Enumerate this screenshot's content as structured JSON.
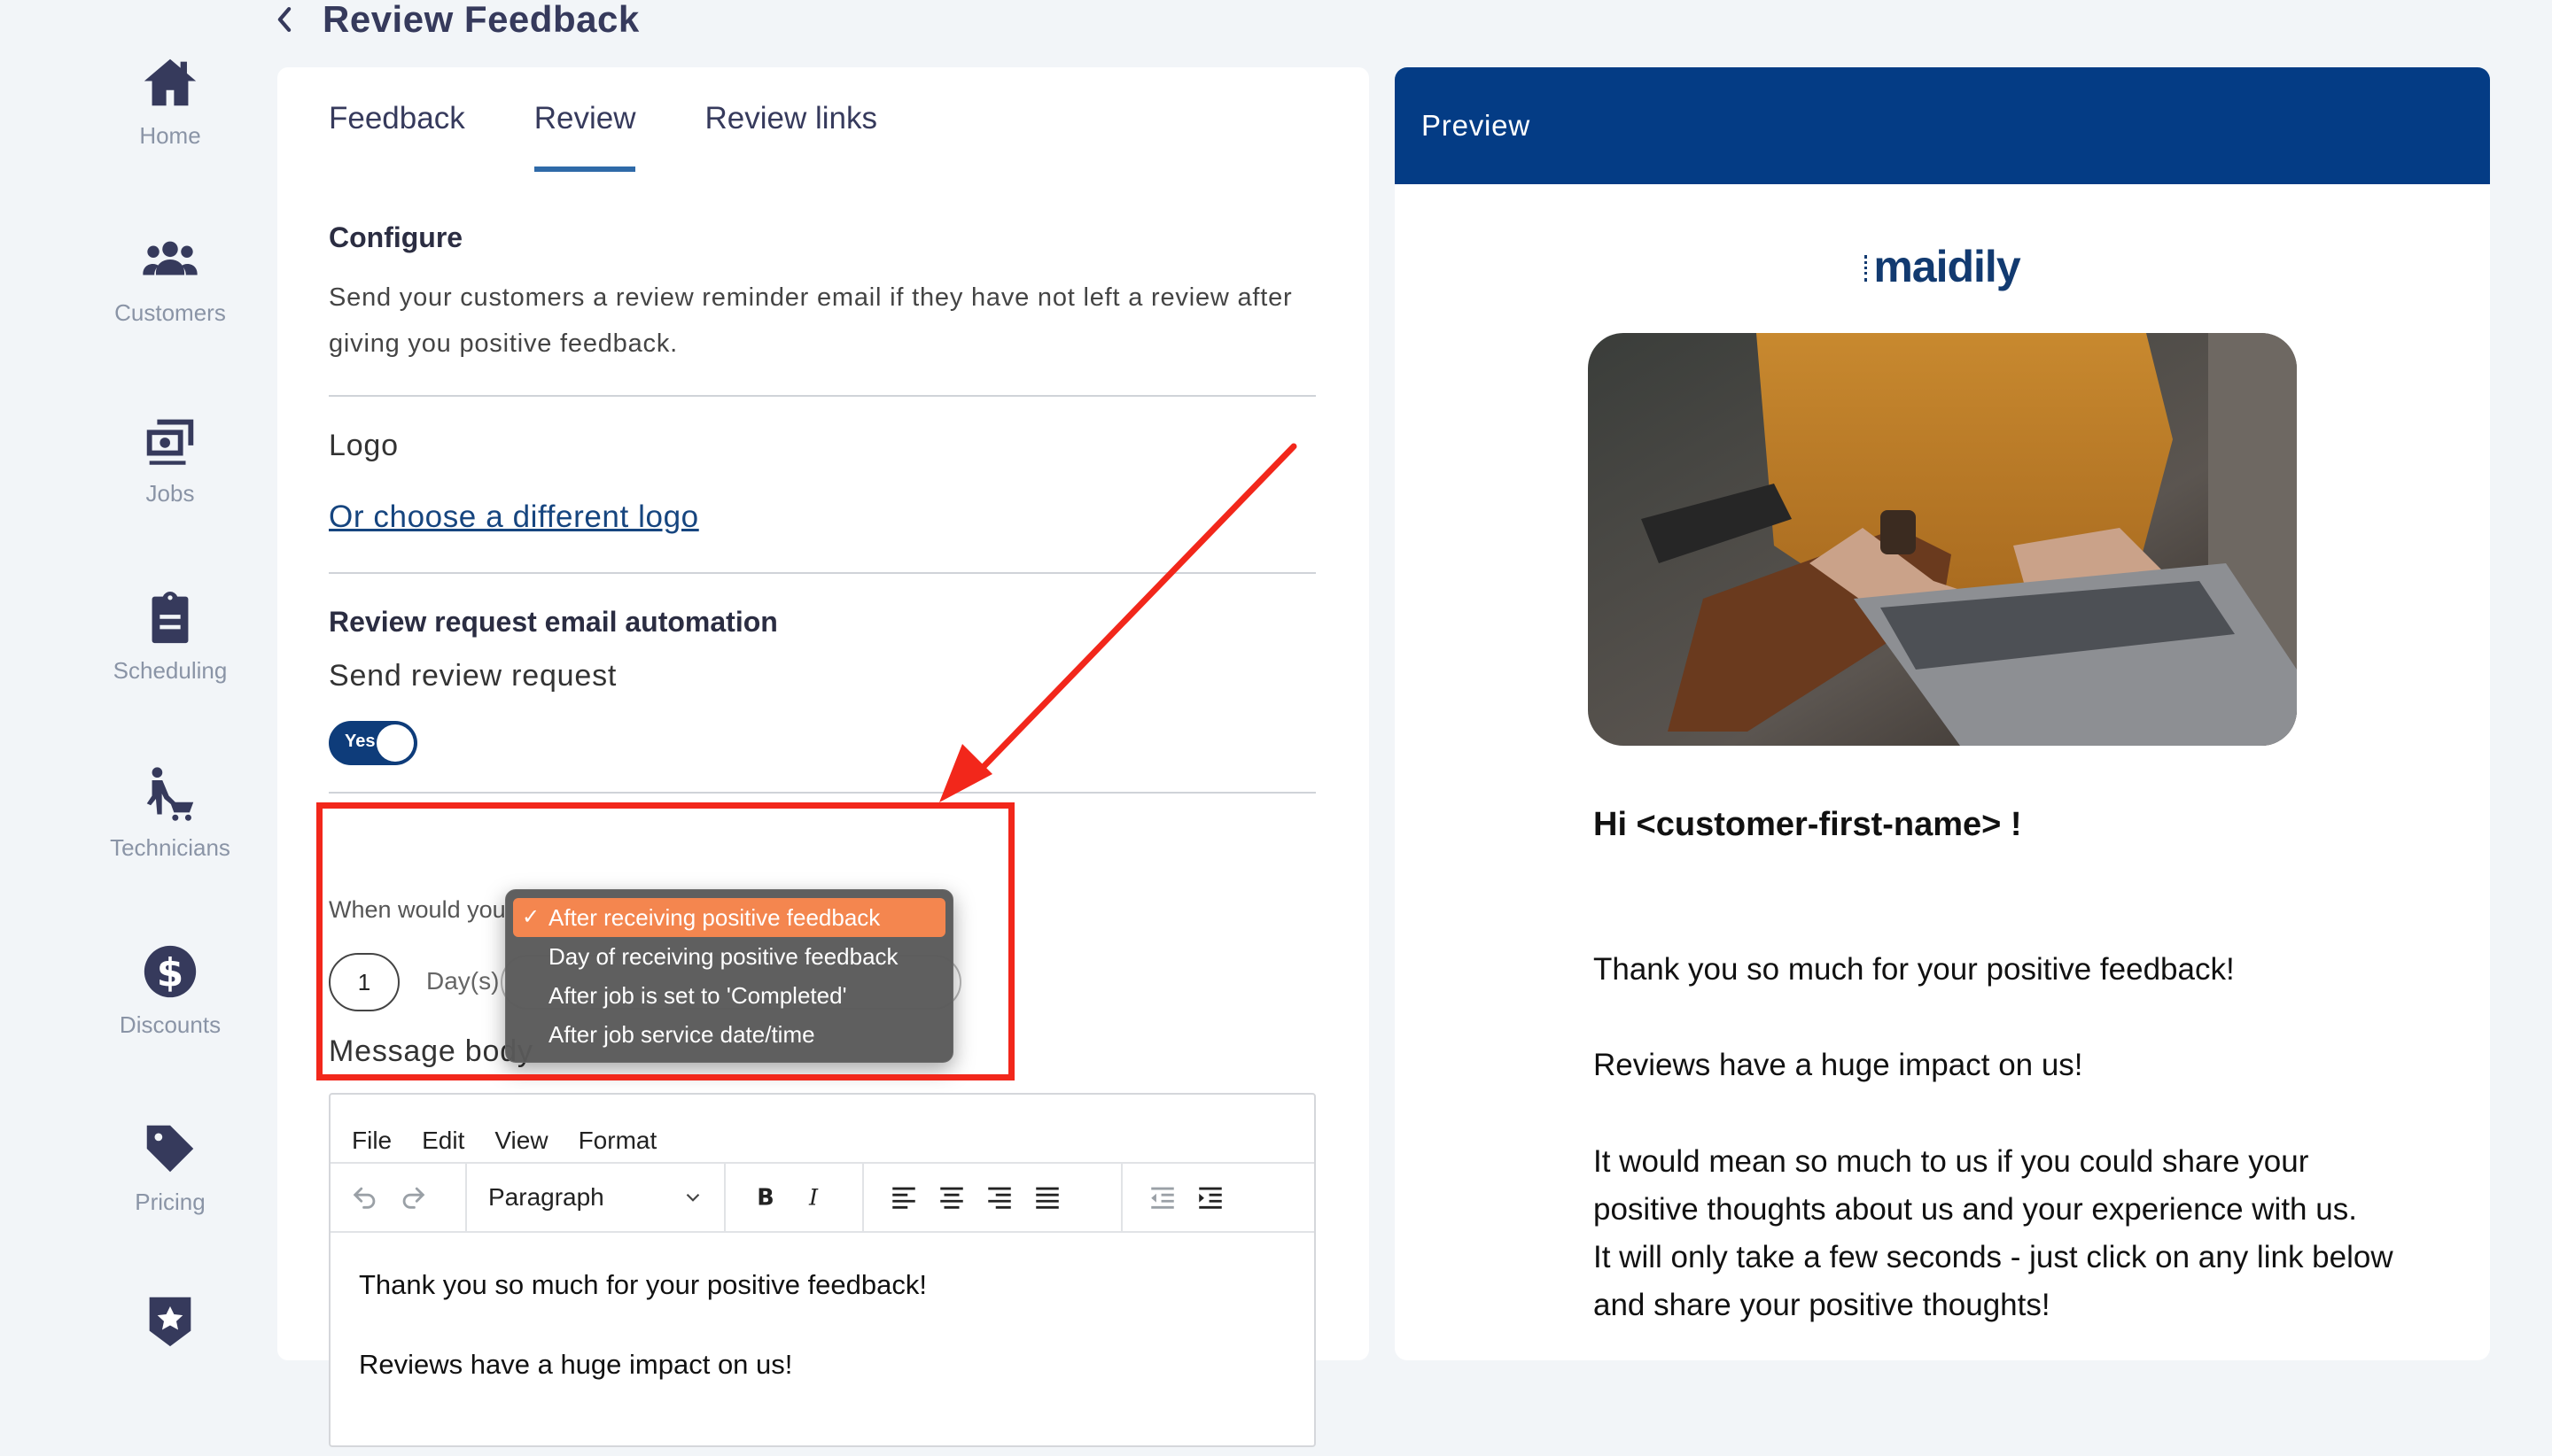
{
  "page": {
    "title": "Review Feedback"
  },
  "sidebar": {
    "items": [
      {
        "label": "Home",
        "icon": "home-icon"
      },
      {
        "label": "Customers",
        "icon": "customers-icon"
      },
      {
        "label": "Jobs",
        "icon": "jobs-icon"
      },
      {
        "label": "Scheduling",
        "icon": "clipboard-icon"
      },
      {
        "label": "Technicians",
        "icon": "technician-icon"
      },
      {
        "label": "Discounts",
        "icon": "dollar-icon"
      },
      {
        "label": "Pricing",
        "icon": "tag-icon"
      },
      {
        "label": "",
        "icon": "star-badge-icon"
      }
    ]
  },
  "tabs": [
    {
      "label": "Feedback",
      "active": false
    },
    {
      "label": "Review",
      "active": true
    },
    {
      "label": "Review links",
      "active": false
    }
  ],
  "configure": {
    "title": "Configure",
    "description_line1": "Send your customers a review reminder email if they have not left a review after",
    "description_line2": "giving you positive feedback."
  },
  "logo_section": {
    "label": "Logo",
    "link": "Or choose a different logo"
  },
  "automation": {
    "title": "Review request email automation",
    "send_label": "Send review request",
    "toggle_text": "Yes",
    "toggle_on": true,
    "question": "When would you like the review request to be sent?",
    "days_value": "1",
    "days_label": "Day(s)",
    "message_label": "Message body"
  },
  "dropdown": {
    "options": [
      {
        "label": "After receiving positive feedback",
        "selected": true
      },
      {
        "label": "Day of receiving positive feedback",
        "selected": false
      },
      {
        "label": "After job is set to 'Completed'",
        "selected": false
      },
      {
        "label": "After job service date/time",
        "selected": false
      }
    ],
    "check": "✓",
    "highlight_color": "#f4864f"
  },
  "editor": {
    "menu": [
      "File",
      "Edit",
      "View",
      "Format"
    ],
    "block_format": "Paragraph",
    "content": [
      "Thank you so much for your positive feedback!",
      "Reviews have a huge impact on us!"
    ]
  },
  "preview": {
    "header": "Preview",
    "brand": "maidily",
    "greeting": "Hi <customer-first-name> !",
    "lines": [
      "Thank you so much for your positive feedback!",
      "Reviews have a huge impact on us!",
      "It would mean so much to us if you could share your",
      "positive thoughts about us and your experience with us.",
      "It will only take a few seconds - just click on any link below",
      "and share your positive thoughts!"
    ]
  },
  "colors": {
    "brand_dark": "#043c85",
    "toggle": "#0e3c7a",
    "annotation": "#f2271b",
    "tab_underline": "#2f6aa8"
  }
}
